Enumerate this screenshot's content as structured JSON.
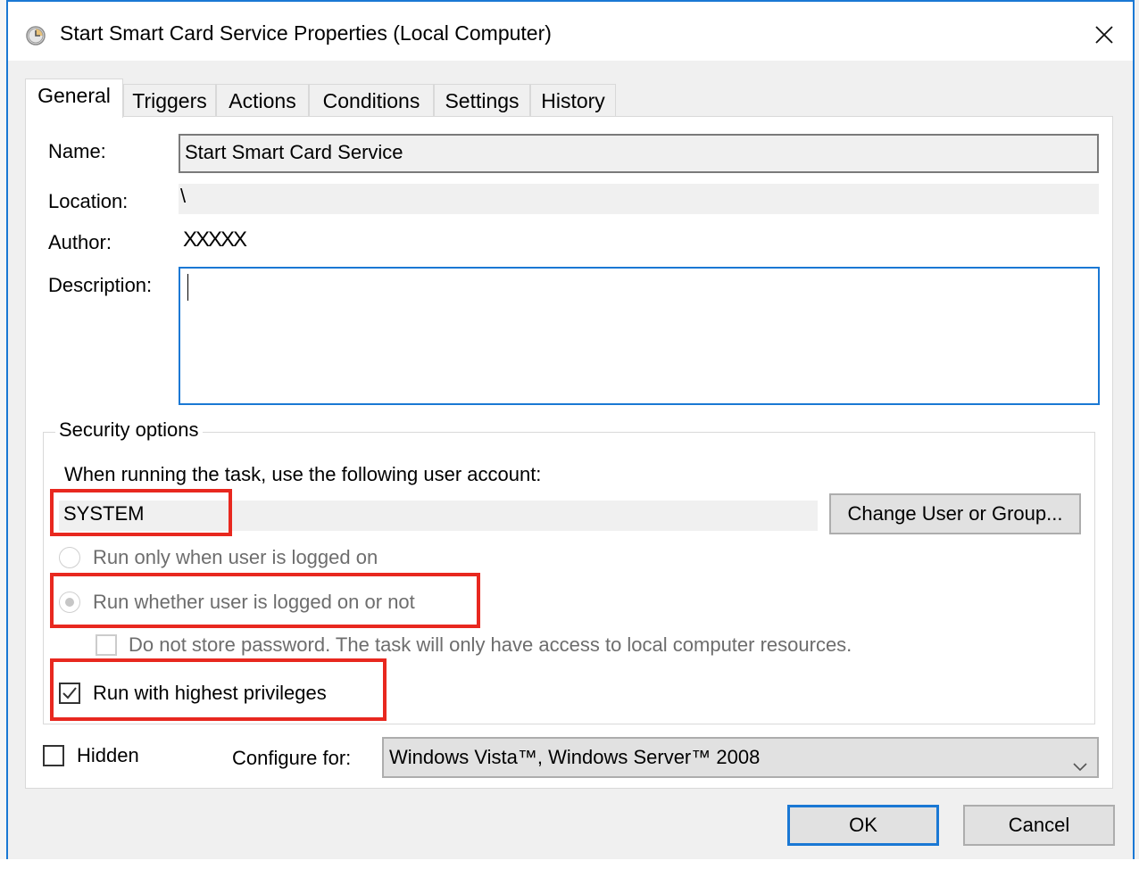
{
  "window": {
    "title": "Start Smart Card Service Properties (Local Computer)",
    "icon": "clock-icon",
    "close_icon": "close-icon"
  },
  "tabs": [
    {
      "label": "General",
      "active": true
    },
    {
      "label": "Triggers",
      "active": false
    },
    {
      "label": "Actions",
      "active": false
    },
    {
      "label": "Conditions",
      "active": false
    },
    {
      "label": "Settings",
      "active": false
    },
    {
      "label": "History",
      "active": false
    }
  ],
  "general": {
    "name_label": "Name:",
    "name_value": "Start Smart Card Service",
    "location_label": "Location:",
    "location_value": "\\",
    "author_label": "Author:",
    "author_value": "XXXXX",
    "description_label": "Description:",
    "description_value": ""
  },
  "security": {
    "title": "Security options",
    "account_prompt": "When running the task, use the following user account:",
    "account_value": "SYSTEM",
    "change_button": "Change User or Group...",
    "radio_logged_on": {
      "label": "Run only when user is logged on",
      "checked": false
    },
    "radio_whether": {
      "label": "Run whether user is logged on or not",
      "checked": true
    },
    "no_store_password": {
      "label": "Do not store password.  The task will only have access to local computer resources.",
      "checked": false
    },
    "highest_privileges": {
      "label": "Run with highest privileges",
      "checked": true
    }
  },
  "footer": {
    "hidden": {
      "label": "Hidden",
      "checked": false
    },
    "configure_label": "Configure for:",
    "configure_value": "Windows Vista™, Windows Server™ 2008",
    "ok_button": "OK",
    "cancel_button": "Cancel"
  },
  "colors": {
    "accent": "#1a78d4",
    "highlight": "#e8281f"
  }
}
